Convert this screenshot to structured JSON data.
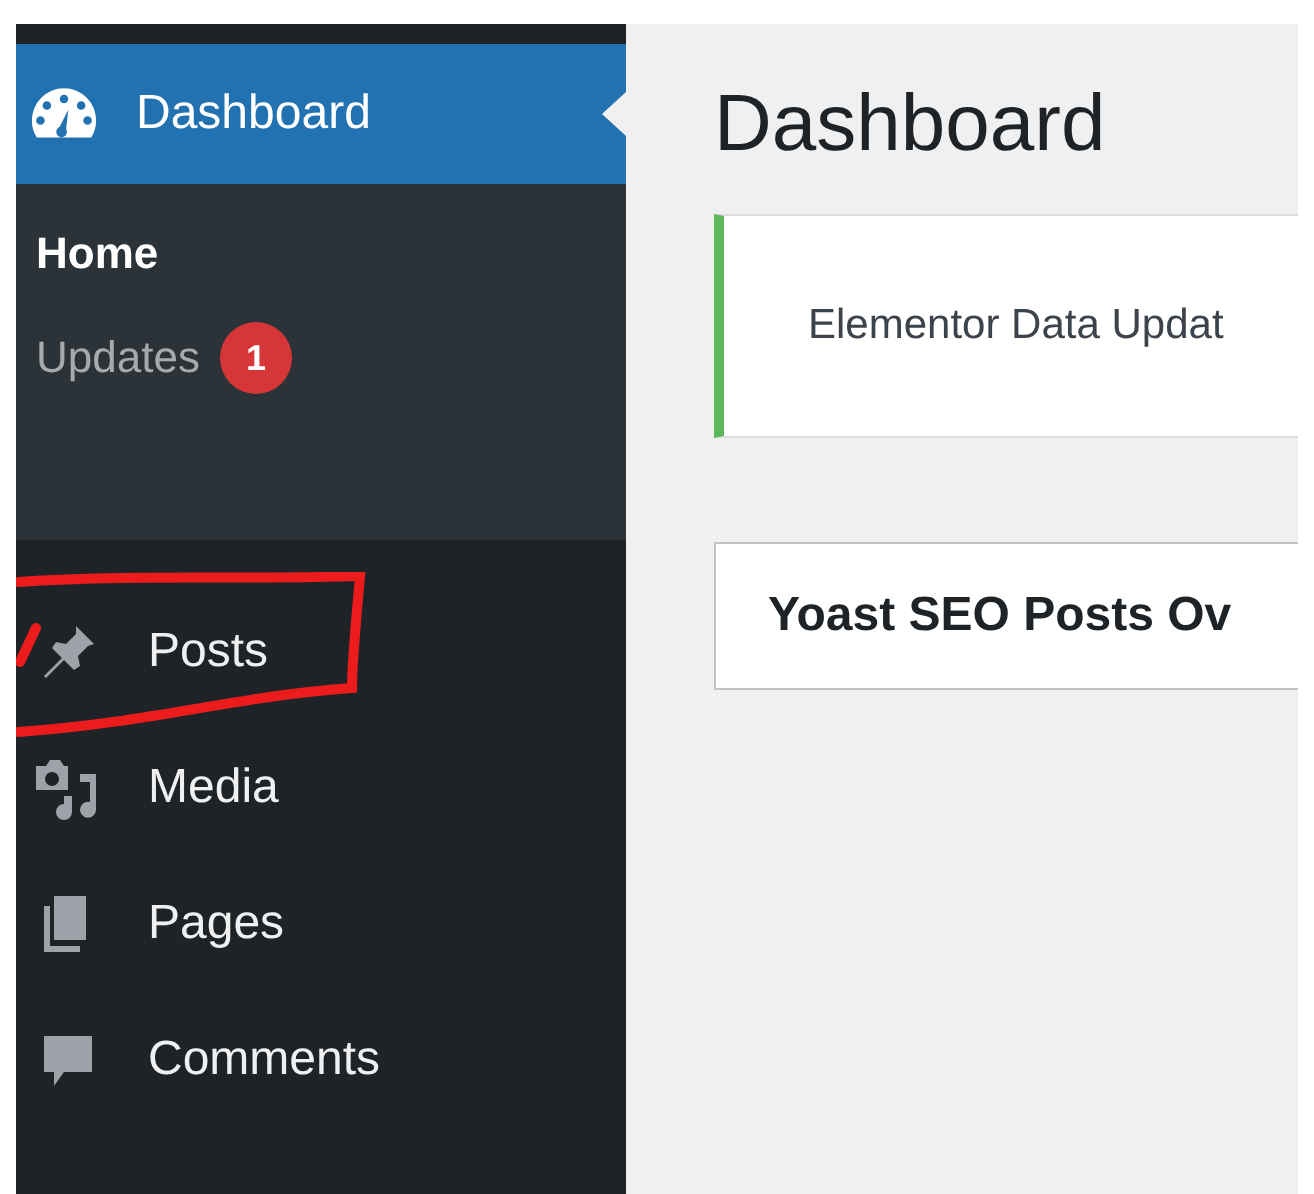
{
  "sidebar": {
    "active": {
      "label": "Dashboard",
      "kind": "dashboard",
      "selected": true
    },
    "submenu": [
      {
        "label": "Home",
        "selected": true
      },
      {
        "label": "Updates",
        "selected": false,
        "badge": "1"
      }
    ],
    "items": [
      {
        "label": "Posts",
        "kind": "pin",
        "selected": false,
        "circled": true
      },
      {
        "label": "Media",
        "kind": "media",
        "selected": false,
        "circled": false
      },
      {
        "label": "Pages",
        "kind": "pages",
        "selected": false,
        "circled": false
      },
      {
        "label": "Comments",
        "kind": "comment",
        "selected": false,
        "circled": false
      }
    ]
  },
  "main": {
    "title": "Dashboard",
    "notice": {
      "text": "Elementor Data Updat"
    },
    "widget": {
      "title": "Yoast SEO Posts Ov"
    }
  }
}
